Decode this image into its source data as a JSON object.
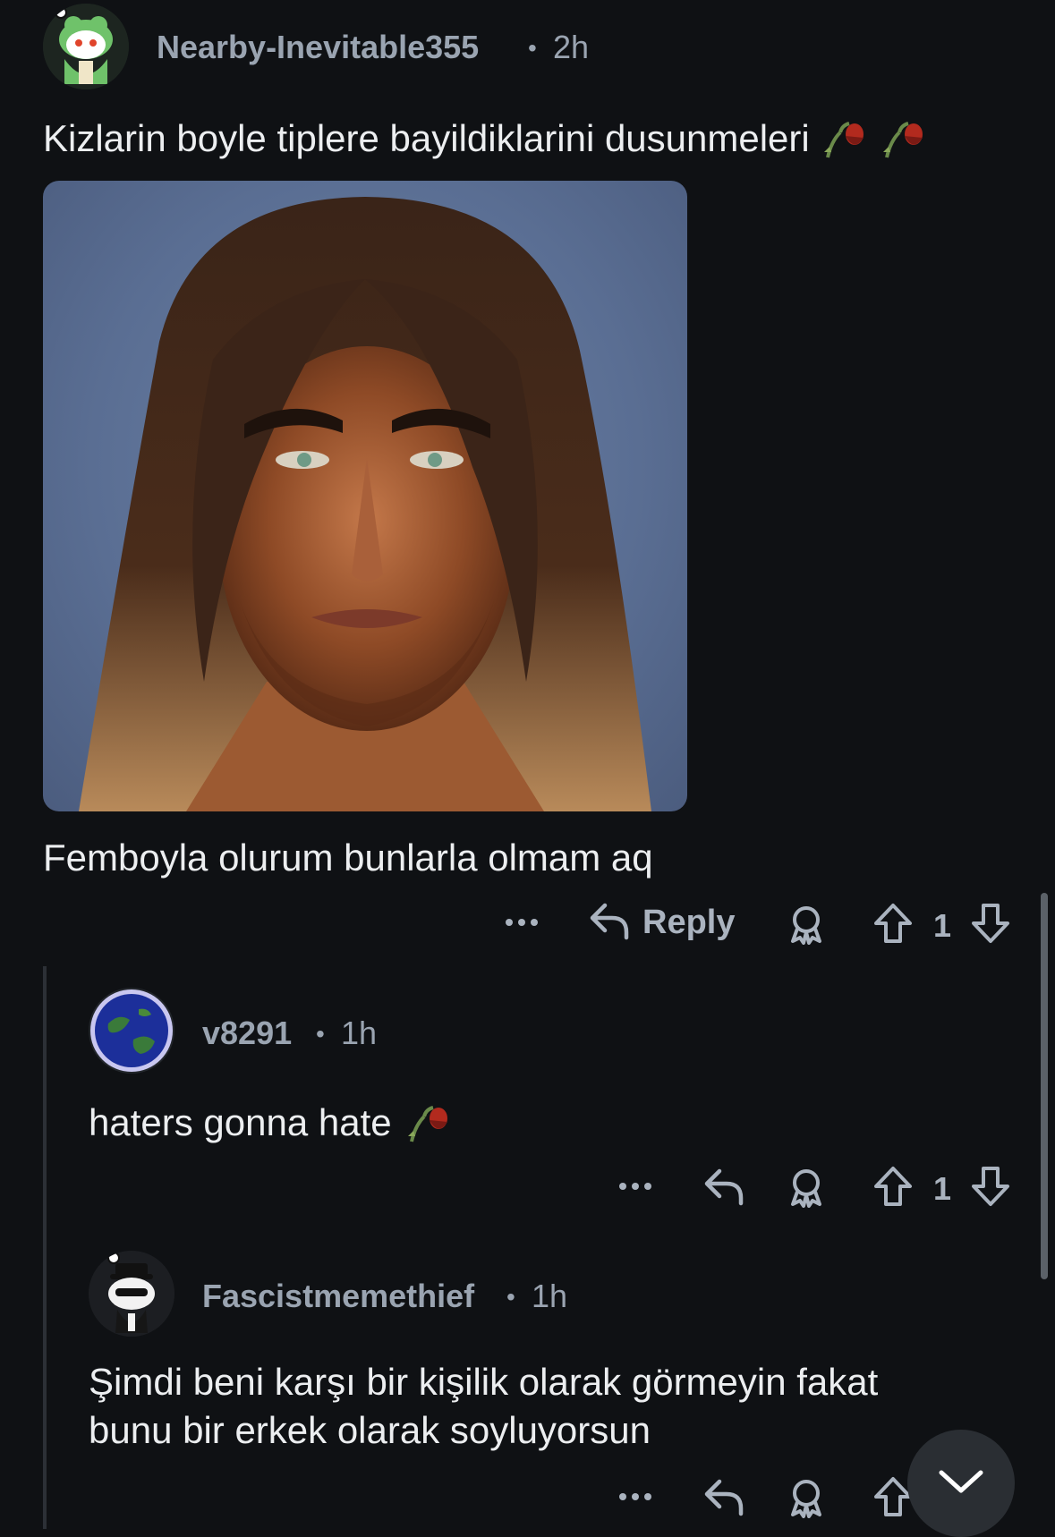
{
  "comments": [
    {
      "username": "Nearby-Inevitable355",
      "time": "2h",
      "text_line1": "Kizlarin boyle tiplere bayildiklarini dusunmeleri",
      "text_after_image": "Femboyla olurum bunlarla olmam aq",
      "emoji": [
        "wilted-rose-icon",
        "wilted-rose-icon"
      ],
      "reply_label": "Reply",
      "score": "1"
    },
    {
      "username": "v8291",
      "time": "1h",
      "text": "haters gonna hate",
      "emoji": [
        "wilted-rose-icon"
      ],
      "score": "1"
    },
    {
      "username": "Fascistmemethief",
      "time": "1h",
      "text_line1": "Şimdi beni karşı bir kişilik olarak görmeyin fakat",
      "text_line2": "bunu bir erkek olarak soyluyorsun"
    }
  ],
  "separator": "•",
  "colors": {
    "background": "#0f1114",
    "meta_text": "#9aa4b1",
    "body_text": "#eceef0",
    "thread_line": "#2c3036"
  },
  "icons": {
    "more": "more-dots-icon",
    "reply": "reply-arrow-icon",
    "award": "award-icon",
    "upvote": "upvote-icon",
    "downvote": "downvote-icon",
    "scroll_down": "chevron-down-icon"
  }
}
